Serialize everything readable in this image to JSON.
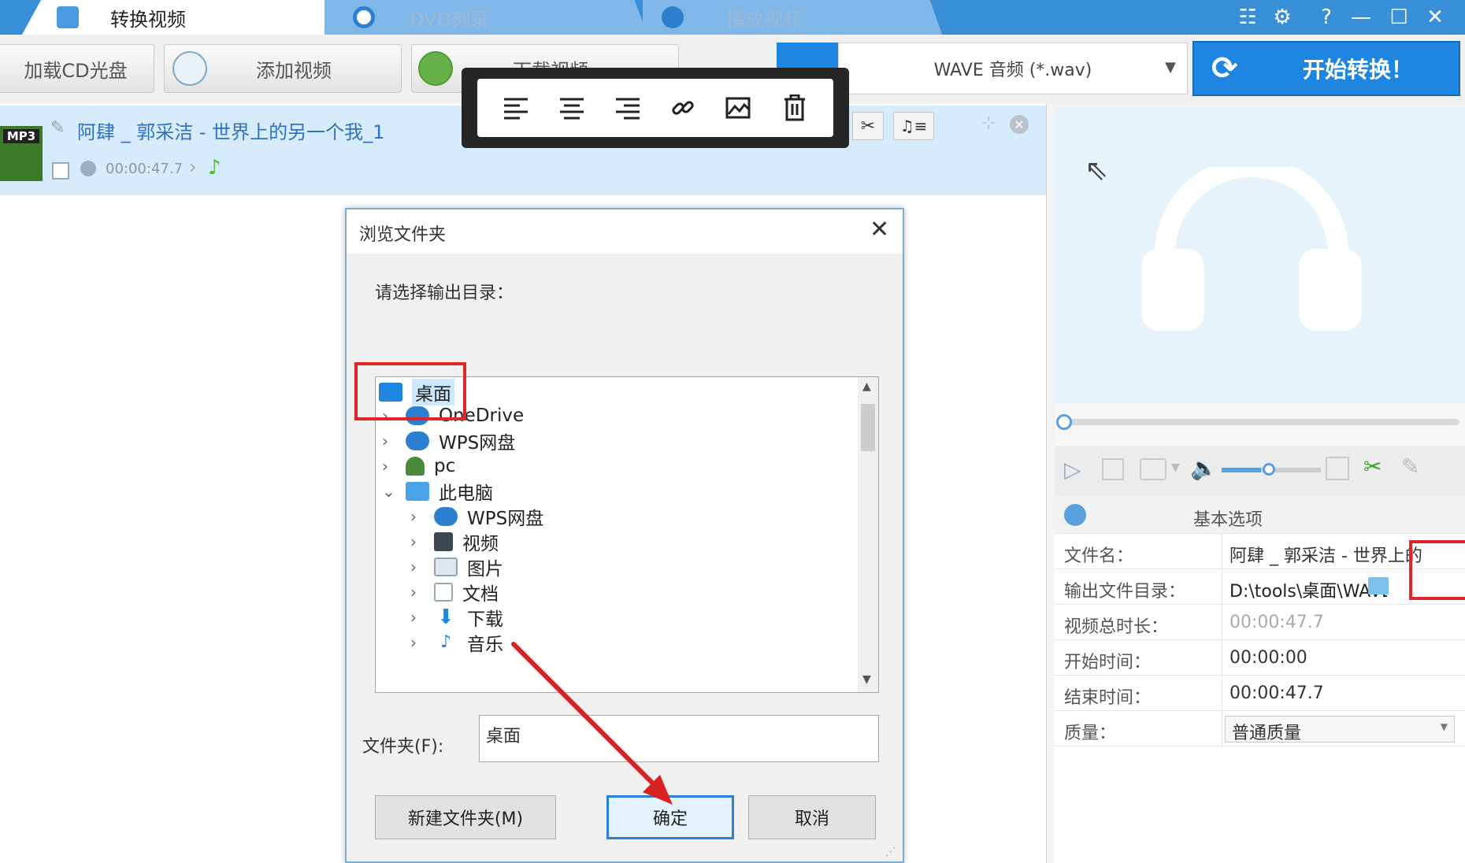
{
  "tabs": [
    {
      "label": "转换视频",
      "state": "active"
    },
    {
      "label": "DVD刻录",
      "state": "inactive"
    },
    {
      "label": "播放视频",
      "state": "inactive"
    }
  ],
  "toolbar": {
    "load_cd": "加载CD光盘",
    "add_video": "添加视频",
    "download_video": "下载视频",
    "format_label": "WAVE 音频 (*.wav)",
    "start_label": "开始转换！"
  },
  "file": {
    "badge": "MP3",
    "title": "阿肆 _ 郭采洁 - 世界上的另一个我_1",
    "duration": "00:00:47.7"
  },
  "dialog": {
    "title": "浏览文件夹",
    "prompt": "请选择输出目录：",
    "tree": [
      {
        "label": "桌面",
        "level": 0,
        "chevron": "",
        "icon": "desktop-icon",
        "selected": true
      },
      {
        "label": "OneDrive",
        "level": 1,
        "chevron": "›",
        "icon": "cloud-icon"
      },
      {
        "label": "WPS网盘",
        "level": 1,
        "chevron": "›",
        "icon": "cloud-icon"
      },
      {
        "label": "pc",
        "level": 1,
        "chevron": "›",
        "icon": "user-icon"
      },
      {
        "label": "此电脑",
        "level": 1,
        "chevron": "⌄",
        "icon": "computer-icon"
      },
      {
        "label": "WPS网盘",
        "level": 2,
        "chevron": "›",
        "icon": "cloud-icon"
      },
      {
        "label": "视频",
        "level": 2,
        "chevron": "›",
        "icon": "video-folder-icon"
      },
      {
        "label": "图片",
        "level": 2,
        "chevron": "›",
        "icon": "picture-folder-icon"
      },
      {
        "label": "文档",
        "level": 2,
        "chevron": "›",
        "icon": "document-folder-icon"
      },
      {
        "label": "下载",
        "level": 2,
        "chevron": "›",
        "icon": "download-folder-icon"
      },
      {
        "label": "音乐",
        "level": 2,
        "chevron": "›",
        "icon": "music-folder-icon"
      }
    ],
    "folder_label": "文件夹(F):",
    "folder_value": "桌面",
    "new_folder": "新建文件夹(M)",
    "ok": "确定",
    "cancel": "取消"
  },
  "options": {
    "header": "基本选项",
    "rows": [
      {
        "label": "文件名：",
        "value": "阿肆 _ 郭采洁 - 世界上的"
      },
      {
        "label": "输出文件目录：",
        "value": "D:\\tools\\桌面\\WAVE"
      },
      {
        "label": "视频总时长：",
        "value": "00:00:47.7"
      },
      {
        "label": "开始时间：",
        "value": "00:00:00"
      },
      {
        "label": "结束时间：",
        "value": "00:00:47.7"
      },
      {
        "label": "质量：",
        "value": "普通质量"
      }
    ]
  },
  "colors": {
    "titlebar": "#3a8fd9",
    "start_button": "#1e86e0",
    "highlight": "#e0262b",
    "selection": "#d6ebfb"
  }
}
